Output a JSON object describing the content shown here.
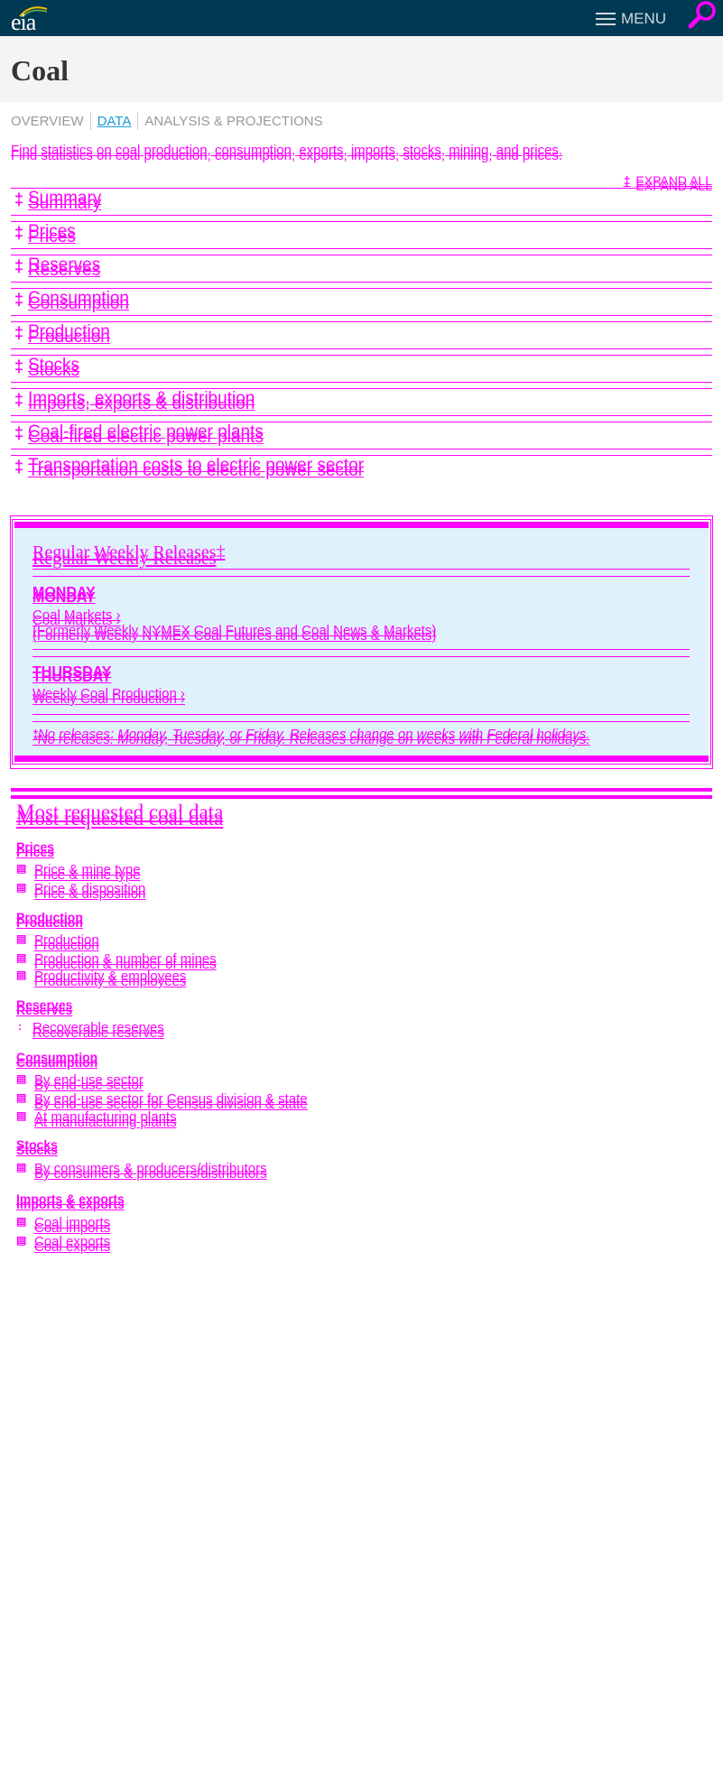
{
  "header": {
    "logo_text": "eia",
    "menu_label": "MENU",
    "colors": {
      "bar": "#003953",
      "accent": "#ff00ff",
      "tab_active": "#1a9bd7"
    }
  },
  "page": {
    "title": "Coal"
  },
  "tabs": [
    {
      "label": "OVERVIEW",
      "active": false
    },
    {
      "label": "DATA",
      "active": true
    },
    {
      "label": "ANALYSIS & PROJECTIONS",
      "active": false
    }
  ],
  "intro": "Find statistics on coal production, consumption, exports, imports, stocks, mining, and prices.",
  "expand_all": "EXPAND ALL",
  "accordion": [
    {
      "label": "Summary"
    },
    {
      "label": "Prices"
    },
    {
      "label": "Reserves"
    },
    {
      "label": "Consumption"
    },
    {
      "label": "Production"
    },
    {
      "label": "Stocks"
    },
    {
      "label": "Imports, exports & distribution"
    },
    {
      "label": "Coal-fired electric power plants"
    },
    {
      "label": "Transportation costs to electric power sector"
    }
  ],
  "weekly": {
    "title": "Regular Weekly Releases",
    "monday": {
      "day": "MONDAY",
      "link": "Coal Markets ›",
      "note": "(Formerly Weekly NYMEX Coal Futures and Coal News & Markets)"
    },
    "thursday": {
      "day": "THURSDAY",
      "link": "Weekly Coal Production ›"
    },
    "footnote": "*No releases: Monday, Tuesday, or Friday. Releases change on weeks with Federal holidays."
  },
  "most_requested": {
    "title": "Most requested coal data",
    "sections": [
      {
        "name": "Prices",
        "items": [
          "Price & mine type",
          "Price & disposition"
        ]
      },
      {
        "name": "Production",
        "items": [
          "Production",
          "Production & number of mines",
          "Productivity & employees"
        ]
      },
      {
        "name": "Reserves",
        "items": [
          "Recoverable reserves"
        ]
      },
      {
        "name": "Consumption",
        "items": [
          "By end-use sector",
          "By end-use sector for Census division & state",
          "At manufacturing plants"
        ]
      },
      {
        "name": "Stocks",
        "items": [
          "By consumers & producers/distributors"
        ]
      },
      {
        "name": "Imports & exports",
        "items": [
          "Coal imports",
          "Coal exports"
        ]
      }
    ]
  }
}
